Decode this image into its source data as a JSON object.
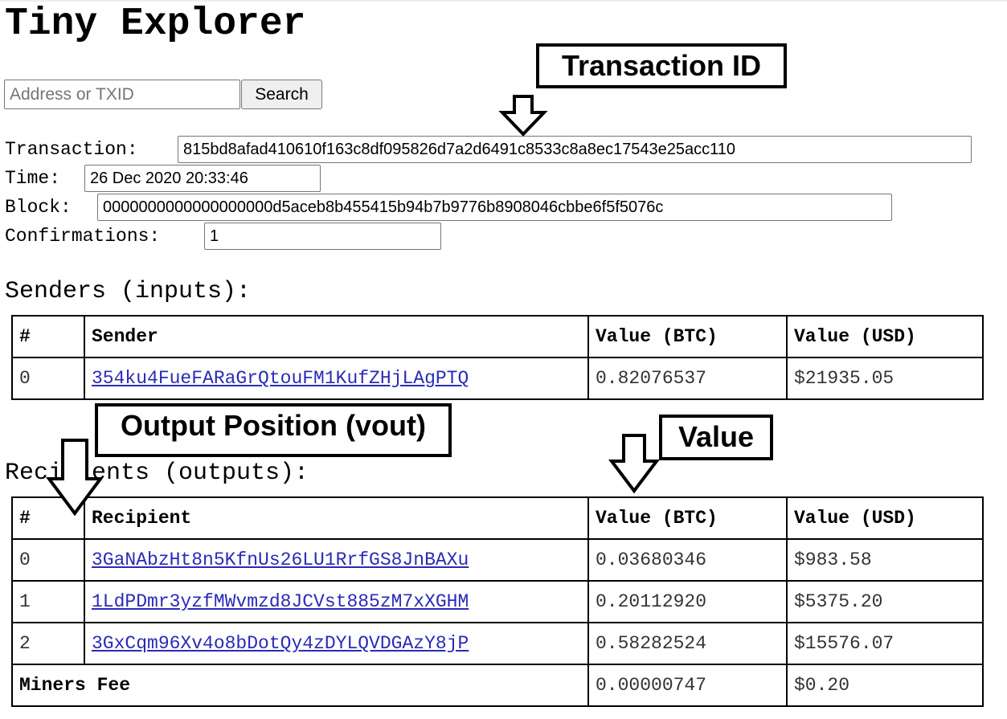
{
  "app": {
    "title": "Tiny Explorer"
  },
  "search": {
    "placeholder": "Address or TXID",
    "button_label": "Search"
  },
  "transaction": {
    "label": "Transaction:",
    "value": "815bd8afad410610f163c8df095826d7a2d6491c8533c8a8ec17543e25acc110"
  },
  "time": {
    "label": "Time:",
    "value": "26 Dec 2020 20:33:46"
  },
  "block": {
    "label": "Block:",
    "value": "0000000000000000000d5aceb8b455415b94b7b9776b8908046cbbe6f5f5076c"
  },
  "confirmations": {
    "label": "Confirmations:",
    "value": "1"
  },
  "senders": {
    "heading": "Senders (inputs):",
    "columns": [
      "#",
      "Sender",
      "Value (BTC)",
      "Value (USD)"
    ],
    "rows": [
      {
        "index": "0",
        "address": "354ku4FueFARaGrQtouFM1KufZHjLAgPTQ",
        "btc": "0.82076537",
        "usd": "$21935.05"
      }
    ]
  },
  "recipients": {
    "heading": "Recipients (outputs):",
    "columns": [
      "#",
      "Recipient",
      "Value (BTC)",
      "Value (USD)"
    ],
    "rows": [
      {
        "index": "0",
        "address": "3GaNAbzHt8n5KfnUs26LU1RrfGS8JnBAXu",
        "btc": "0.03680346",
        "usd": "$983.58"
      },
      {
        "index": "1",
        "address": "1LdPDmr3yzfMWvmzd8JCVst885zM7xXGHM",
        "btc": "0.20112920",
        "usd": "$5375.20"
      },
      {
        "index": "2",
        "address": "3GxCqm96Xv4o8bDotQy4zDYLQVDGAzY8jP",
        "btc": "0.58282524",
        "usd": "$15576.07"
      }
    ],
    "fee": {
      "label": "Miners Fee",
      "btc": "0.00000747",
      "usd": "$0.20"
    }
  },
  "annotations": {
    "transaction_id": "Transaction ID",
    "output_position": "Output Position (vout)",
    "value": "Value"
  }
}
